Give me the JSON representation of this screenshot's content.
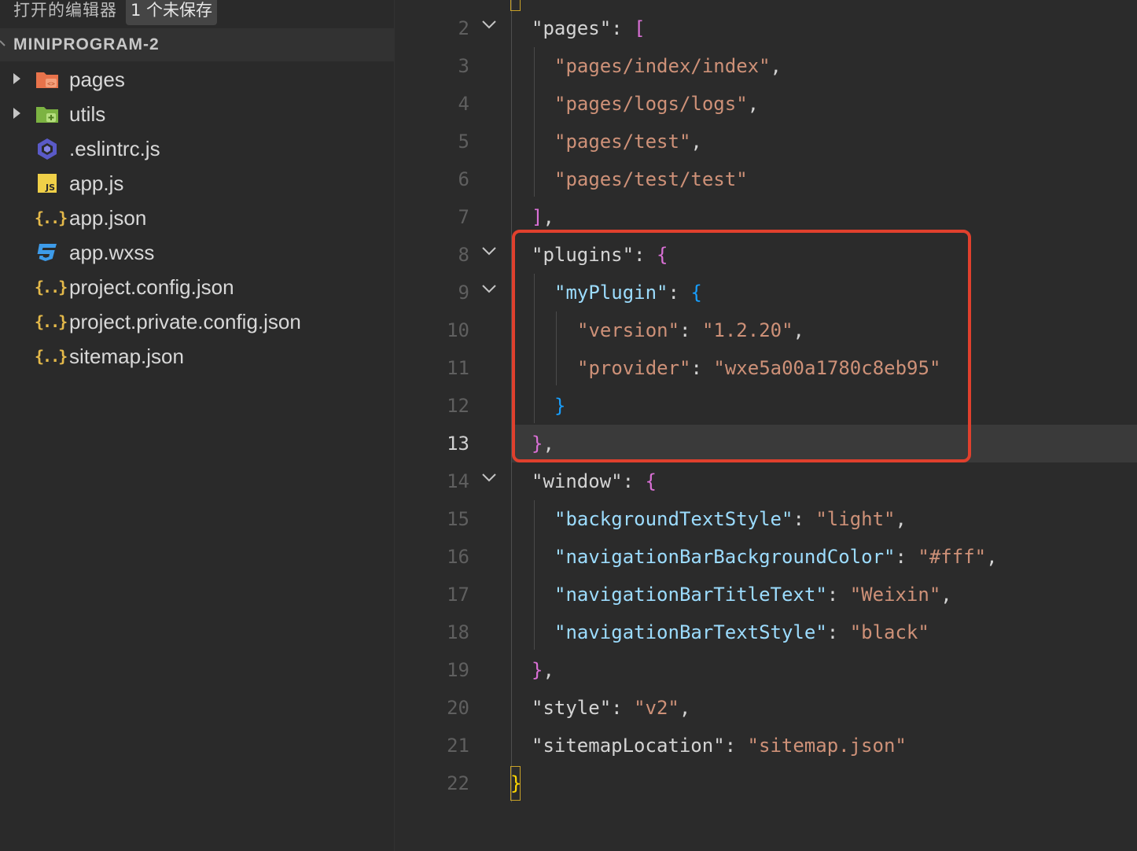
{
  "sidebar": {
    "open_editors_title": "打开的编辑器",
    "unsaved_badge": "1 个未保存",
    "project_title": "MINIPROGRAM-2",
    "items": [
      {
        "name": "pages",
        "kind": "folder",
        "icon": "folder-pages-icon",
        "icon_color": "#e8734b"
      },
      {
        "name": "utils",
        "kind": "folder",
        "icon": "folder-utils-icon",
        "icon_color": "#7cb342"
      },
      {
        "name": ".eslintrc.js",
        "kind": "file",
        "icon": "eslint-icon",
        "icon_color": "#5a5ac7"
      },
      {
        "name": "app.js",
        "kind": "file",
        "icon": "js-file-icon",
        "icon_color": "#f0d048"
      },
      {
        "name": "app.json",
        "kind": "file",
        "icon": "json-file-icon",
        "icon_color": "#e4b94a"
      },
      {
        "name": "app.wxss",
        "kind": "file",
        "icon": "css-file-icon",
        "icon_color": "#3d9be9"
      },
      {
        "name": "project.config.json",
        "kind": "file",
        "icon": "json-file-icon",
        "icon_color": "#e4b94a"
      },
      {
        "name": "project.private.config.json",
        "kind": "file",
        "icon": "json-file-icon",
        "icon_color": "#e4b94a"
      },
      {
        "name": "sitemap.json",
        "kind": "file",
        "icon": "json-file-icon",
        "icon_color": "#e4b94a"
      }
    ]
  },
  "editor": {
    "active_line": "13",
    "lines": {
      "l2": {
        "n": "2",
        "key": "\"pages\"",
        "colon": ": ",
        "open": "["
      },
      "l3": {
        "n": "3",
        "str": "\"pages/index/index\"",
        "tail": ","
      },
      "l4": {
        "n": "4",
        "str": "\"pages/logs/logs\"",
        "tail": ","
      },
      "l5": {
        "n": "5",
        "str": "\"pages/test\"",
        "tail": ","
      },
      "l6": {
        "n": "6",
        "str": "\"pages/test/test\""
      },
      "l7": {
        "n": "7",
        "close": "]",
        "tail": ","
      },
      "l8": {
        "n": "8",
        "key": "\"plugins\"",
        "colon": ": ",
        "open": "{"
      },
      "l9": {
        "n": "9",
        "key": "\"myPlugin\"",
        "colon": ": ",
        "open": "{"
      },
      "l10": {
        "n": "10",
        "key": "\"version\"",
        "colon": ": ",
        "str": "\"1.2.20\"",
        "tail": ","
      },
      "l11": {
        "n": "11",
        "key": "\"provider\"",
        "colon": ": ",
        "str": "\"wxe5a00a1780c8eb95\""
      },
      "l12": {
        "n": "12",
        "close": "}"
      },
      "l13": {
        "n": "13",
        "close": "}",
        "tail": ","
      },
      "l14": {
        "n": "14",
        "key": "\"window\"",
        "colon": ": ",
        "open": "{"
      },
      "l15": {
        "n": "15",
        "key": "\"backgroundTextStyle\"",
        "colon": ": ",
        "str": "\"light\"",
        "tail": ","
      },
      "l16": {
        "n": "16",
        "key": "\"navigationBarBackgroundColor\"",
        "colon": ": ",
        "str": "\"#fff\"",
        "tail": ","
      },
      "l17": {
        "n": "17",
        "key": "\"navigationBarTitleText\"",
        "colon": ": ",
        "str": "\"Weixin\"",
        "tail": ","
      },
      "l18": {
        "n": "18",
        "key": "\"navigationBarTextStyle\"",
        "colon": ": ",
        "str": "\"black\""
      },
      "l19": {
        "n": "19",
        "close": "}",
        "tail": ","
      },
      "l20": {
        "n": "20",
        "key": "\"style\"",
        "colon": ": ",
        "str": "\"v2\"",
        "tail": ","
      },
      "l21": {
        "n": "21",
        "key": "\"sitemapLocation\"",
        "colon": ": ",
        "str": "\"sitemap.json\""
      },
      "l22": {
        "n": "22",
        "close": "}"
      }
    }
  },
  "colors": {
    "annotation_box": "#e0402d",
    "string": "#ce9178",
    "key": "#9cdcfe",
    "bracket_pink": "#da70d6",
    "bracket_blue": "#179fff",
    "bracket_gold": "#ffd700"
  }
}
